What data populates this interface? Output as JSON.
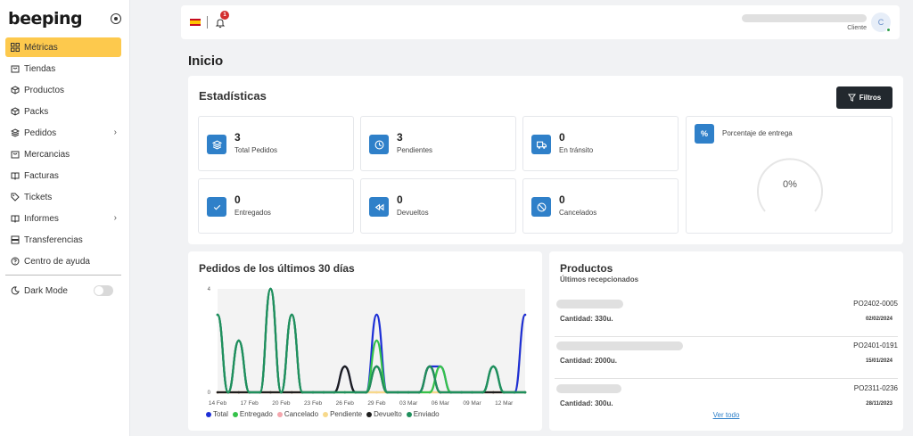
{
  "app": {
    "logo": "beeping"
  },
  "sidebar": {
    "items": [
      {
        "label": "Métricas",
        "icon": "grid-icon",
        "active": true
      },
      {
        "label": "Tiendas",
        "icon": "store-icon"
      },
      {
        "label": "Productos",
        "icon": "box-icon"
      },
      {
        "label": "Packs",
        "icon": "package-icon"
      },
      {
        "label": "Pedidos",
        "icon": "layers-icon",
        "submenu": true
      },
      {
        "label": "Mercancias",
        "icon": "store-icon"
      },
      {
        "label": "Facturas",
        "icon": "book-icon"
      },
      {
        "label": "Tickets",
        "icon": "tag-icon"
      },
      {
        "label": "Informes",
        "icon": "book-icon",
        "submenu": true
      },
      {
        "label": "Transferencias",
        "icon": "server-icon"
      },
      {
        "label": "Centro de ayuda",
        "icon": "help-icon"
      }
    ],
    "dark_mode_label": "Dark Mode",
    "dark_mode_on": false
  },
  "topbar": {
    "language_flag": "ES",
    "notification_count": "1",
    "user_role": "Cliente",
    "avatar_initial": "C"
  },
  "page": {
    "title": "Inicio"
  },
  "stats": {
    "title": "Estadísticas",
    "filter_label": "Filtros",
    "cards": [
      {
        "value": "3",
        "label": "Total Pedidos",
        "icon": "layers-icon"
      },
      {
        "value": "3",
        "label": "Pendientes",
        "icon": "clock-icon"
      },
      {
        "value": "0",
        "label": "En tránsito",
        "icon": "truck-icon"
      },
      {
        "value": "0",
        "label": "Entregados",
        "icon": "check-icon"
      },
      {
        "value": "0",
        "label": "Devueltos",
        "icon": "rewind-icon"
      },
      {
        "value": "0",
        "label": "Cancelados",
        "icon": "ban-icon"
      }
    ],
    "delivery": {
      "label": "Porcentaje de entrega",
      "value": "0%",
      "icon": "percent-icon"
    }
  },
  "orders_chart": {
    "title": "Pedidos de los últimos 30 días",
    "legend": [
      {
        "name": "Total",
        "color": "#1d2fd6"
      },
      {
        "name": "Entregado",
        "color": "#35c24a"
      },
      {
        "name": "Cancelado",
        "color": "#f4a6ad"
      },
      {
        "name": "Pendiente",
        "color": "#f7d98b"
      },
      {
        "name": "Devuelto",
        "color": "#1d1d1d"
      },
      {
        "name": "Enviado",
        "color": "#1f8f5c"
      }
    ]
  },
  "chart_data": {
    "type": "line",
    "title": "Pedidos de los últimos 30 días",
    "xlabel": "",
    "ylabel": "",
    "ylim": [
      0,
      4
    ],
    "yticks": [
      "0",
      "4"
    ],
    "x": [
      "14 Feb",
      "15 Feb",
      "16 Feb",
      "17 Feb",
      "18 Feb",
      "19 Feb",
      "20 Feb",
      "21 Feb",
      "22 Feb",
      "23 Feb",
      "24 Feb",
      "25 Feb",
      "26 Feb",
      "27 Feb",
      "28 Feb",
      "29 Feb",
      "01 Mar",
      "02 Mar",
      "03 Mar",
      "04 Mar",
      "05 Mar",
      "06 Mar",
      "07 Mar",
      "08 Mar",
      "09 Mar",
      "10 Mar",
      "11 Mar",
      "12 Mar",
      "13 Mar",
      "14 Mar"
    ],
    "xtick_labels": [
      "14 Feb",
      "17 Feb",
      "20 Feb",
      "23 Feb",
      "26 Feb",
      "29 Feb",
      "03 Mar",
      "06 Mar",
      "09 Mar",
      "12 Mar"
    ],
    "series": [
      {
        "name": "Total",
        "color": "#1d2fd6",
        "values": [
          3,
          0,
          2,
          0,
          0,
          4,
          0,
          3,
          0,
          0,
          0,
          0,
          1,
          0,
          0,
          3,
          0,
          0,
          0,
          0,
          1,
          1,
          0,
          0,
          0,
          0,
          1,
          0,
          0,
          3
        ]
      },
      {
        "name": "Entregado",
        "color": "#35c24a",
        "values": [
          3,
          0,
          2,
          0,
          0,
          4,
          0,
          3,
          0,
          0,
          0,
          0,
          0,
          0,
          0,
          2,
          0,
          0,
          0,
          0,
          0,
          1,
          0,
          0,
          0,
          0,
          1,
          0,
          0,
          0
        ]
      },
      {
        "name": "Cancelado",
        "color": "#f4a6ad",
        "values": [
          0,
          0,
          0,
          0,
          0,
          0,
          0,
          0,
          0,
          0,
          0,
          0,
          0,
          0,
          0,
          0,
          0,
          0,
          0,
          0,
          0,
          0,
          0,
          0,
          0,
          0,
          0,
          0,
          0,
          0
        ]
      },
      {
        "name": "Pendiente",
        "color": "#f7d98b",
        "values": [
          0,
          0,
          0,
          0,
          0,
          0,
          0,
          0,
          0,
          0,
          0,
          0,
          0,
          0,
          0,
          0,
          0,
          0,
          0,
          0,
          0,
          0,
          0,
          0,
          0,
          0,
          0,
          0,
          0,
          3
        ]
      },
      {
        "name": "Devuelto",
        "color": "#1d1d1d",
        "values": [
          0,
          0,
          0,
          0,
          0,
          0,
          0,
          0,
          0,
          0,
          0,
          0,
          1,
          0,
          0,
          1,
          0,
          0,
          0,
          0,
          1,
          0,
          0,
          0,
          0,
          0,
          0,
          0,
          0,
          0
        ]
      },
      {
        "name": "Enviado",
        "color": "#1f8f5c",
        "values": [
          3,
          0,
          2,
          0,
          0,
          4,
          0,
          3,
          0,
          0,
          0,
          0,
          0,
          0,
          0,
          1,
          0,
          0,
          0,
          0,
          1,
          0,
          0,
          0,
          0,
          0,
          1,
          0,
          0,
          0
        ]
      }
    ]
  },
  "products": {
    "title": "Productos",
    "subtitle": "Últimos recepcionados",
    "view_all": "Ver todo",
    "items": [
      {
        "code": "PO2402-0005",
        "quantity": "Cantidad: 330u.",
        "date": "02/02/2024"
      },
      {
        "code": "PO2401-0191",
        "quantity": "Cantidad: 2000u.",
        "date": "15/01/2024"
      },
      {
        "code": "PO2311-0236",
        "quantity": "Cantidad: 300u.",
        "date": "28/11/2023"
      }
    ]
  }
}
